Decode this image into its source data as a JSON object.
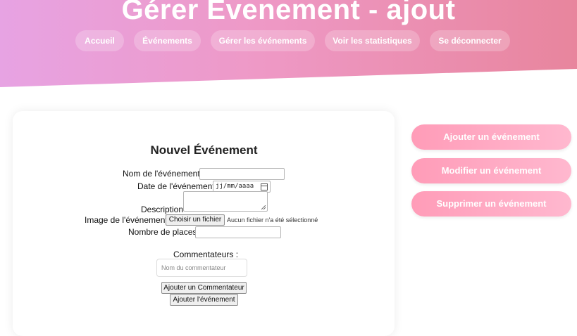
{
  "header": {
    "title": "Gérer Évenement - ajout",
    "nav": [
      {
        "label": "Accueil"
      },
      {
        "label": "Événements"
      },
      {
        "label": "Gérer les événements"
      },
      {
        "label": "Voir les statistiques"
      },
      {
        "label": "Se déconnecter"
      }
    ]
  },
  "form": {
    "title": "Nouvel Événement",
    "name_label": "Nom de l'événement",
    "name_value": "",
    "date_label": "Date de l'événement",
    "date_placeholder": "jj/mm/aaaa",
    "description_label": "Description",
    "description_value": "",
    "image_label": "Image de l'événement",
    "file_button": "Choisir un fichier",
    "file_status": "Aucun fichier n'a été sélectionné",
    "places_label": "Nombre de places",
    "places_value": "",
    "commentators_label": "Commentateurs :",
    "commentator_placeholder": "Nom du commentateur",
    "add_commentator_button": "Ajouter un Commentateur",
    "submit_button": "Ajouter l'événement"
  },
  "actions": [
    {
      "label": "Ajouter un événement"
    },
    {
      "label": "Modifier un événement"
    },
    {
      "label": "Supprimer un événement"
    }
  ],
  "colors": {
    "header_gradient_start": "#e7a3e3",
    "header_gradient_end": "#e8859d",
    "action_button": "#ff9cb8"
  }
}
